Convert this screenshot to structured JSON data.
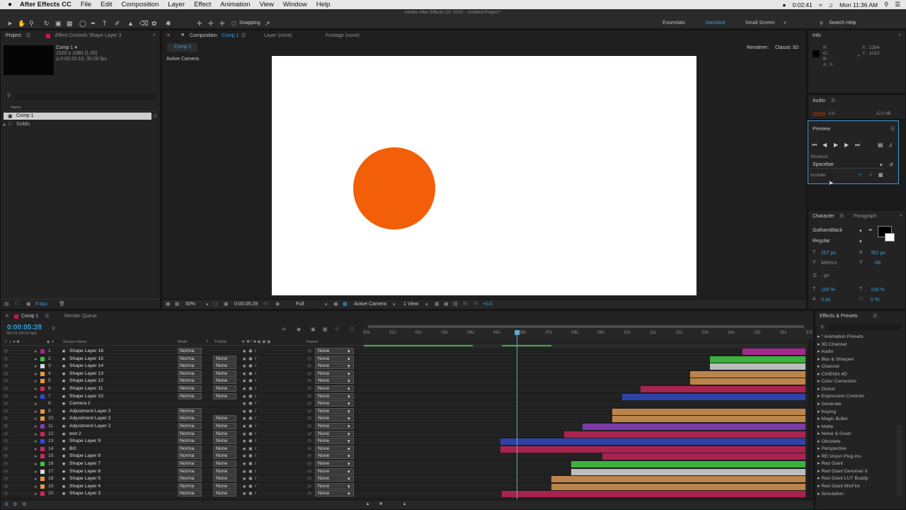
{
  "menubar": {
    "app": "After Effects CC",
    "items": [
      "File",
      "Edit",
      "Composition",
      "Layer",
      "Effect",
      "Animation",
      "View",
      "Window",
      "Help"
    ],
    "time": "0:02:41",
    "clock": "Mon 11:36 AM"
  },
  "app_title": "Adobe After Effects CC 2015 - Untitled Project *",
  "toolbar": {
    "snapping": "Snapping",
    "workspaces": [
      "Essentials",
      "Standard",
      "Small Screen"
    ],
    "active_workspace": "Standard",
    "search_help": "Search Help"
  },
  "project": {
    "tab": "Project",
    "effect_controls": "Effect Controls Shape Layer 3",
    "comp_name": "Comp 1 ▾",
    "comp_info1": "1920 x 1080 (1.00)",
    "comp_info2": "Δ 0:00:20:10, 30.00 fps",
    "col_name": "Name",
    "items": [
      "Comp 1",
      "Solids"
    ],
    "bpc": "8 bpc"
  },
  "composition": {
    "tab_prefix": "Composition",
    "tab_name": "Comp 1",
    "layer_tab": "Layer (none)",
    "footage_tab": "Footage (none)",
    "crumb": "Comp 1",
    "renderer_label": "Renderer:",
    "renderer": "Classic 3D",
    "camera": "Active Camera",
    "zoom": "50%",
    "timecode": "0:00:05:28",
    "resolution": "Full",
    "camera_select": "Active Camera",
    "view": "1 View",
    "exposure": "+0.0",
    "circle_color": "#f25f08"
  },
  "info": {
    "title": "Info",
    "r": "R :",
    "g": "G :",
    "b": "B :",
    "a": "A : 0",
    "x": "X : 2294",
    "y": "Y : 1010"
  },
  "audio": {
    "title": "Audio",
    "left": "0.0",
    "right": "12.0 dB"
  },
  "preview": {
    "title": "Preview",
    "shortcut_label": "Shortcut",
    "shortcut": "Spacebar",
    "include": "Include:"
  },
  "character": {
    "tab1": "Character",
    "tab2": "Paragraph",
    "font": "GothamBlack",
    "style": "Regular",
    "size": "257 px",
    "leading": "352 px",
    "kerning": "Metrics",
    "tracking": "-68",
    "stroke": "- px",
    "vscale": "100 %",
    "hscale": "100 %",
    "baseline": "0 px",
    "tsume": "0 %"
  },
  "timeline": {
    "tab": "Comp 1",
    "render_queue": "Render Queue",
    "timecode": "0:00:05:28",
    "frames": "00178 (30.00 fps)",
    "col_source": "Source Name",
    "col_mode": "Mode",
    "col_t": "T",
    "col_trkmat": "TrkMat",
    "col_parent": "Parent",
    "ruler": [
      "00s",
      "01s",
      "02s",
      "03s",
      "04s",
      "05s",
      "06s",
      "07s",
      "08s",
      "09s",
      "10s",
      "11s",
      "12s",
      "13s",
      "14s",
      "15s",
      "16s",
      "17s"
    ],
    "layers": [
      {
        "n": "1",
        "name": "Shape Layer 16",
        "color": "#b3238f",
        "mode": "Norma",
        "trk": "",
        "parent": "None",
        "bar": [
          1048,
          1137
        ],
        "barcolor": "#a32a8c"
      },
      {
        "n": "2",
        "name": "Shape Layer 15",
        "color": "#3fc23f",
        "mode": "Norma",
        "trk": "None",
        "parent": "None",
        "bar": [
          1002,
          1137
        ],
        "barcolor": "#3bb23b"
      },
      {
        "n": "3",
        "name": "Shape Layer 14",
        "color": "#d9d9d9",
        "mode": "Norma",
        "trk": "None",
        "parent": "None",
        "bar": [
          1002,
          1137
        ],
        "barcolor": "#bdbdbd"
      },
      {
        "n": "4",
        "name": "Shape Layer 13",
        "color": "#e89a3c",
        "mode": "Norma",
        "trk": "None",
        "parent": "None",
        "bar": [
          974,
          1137
        ],
        "barcolor": "#bb844a"
      },
      {
        "n": "5",
        "name": "Shape Layer 12",
        "color": "#e89a3c",
        "mode": "Norma",
        "trk": "None",
        "parent": "None",
        "bar": [
          974,
          1137
        ],
        "barcolor": "#bb844a"
      },
      {
        "n": "6",
        "name": "Shape Layer 11",
        "color": "#d0275a",
        "mode": "Norma",
        "trk": "None",
        "parent": "None",
        "bar": [
          904,
          1137
        ],
        "barcolor": "#a8244f"
      },
      {
        "n": "7",
        "name": "Shape Layer 10",
        "color": "#2f4bd0",
        "mode": "Norma",
        "trk": "None",
        "parent": "None",
        "bar": [
          878,
          1137
        ],
        "barcolor": "#2f42a8"
      },
      {
        "n": "8",
        "name": "Camera 2",
        "color": "",
        "mode": "",
        "trk": "",
        "parent": "None",
        "bar": null,
        "barcolor": ""
      },
      {
        "n": "9",
        "name": "Adjustment Layer 2",
        "color": "#e89a3c",
        "mode": "Norma",
        "trk": "",
        "parent": "None",
        "bar": [
          864,
          1137
        ],
        "barcolor": "#bb844a"
      },
      {
        "n": "10",
        "name": "Adjustment Layer 2",
        "color": "#e89a3c",
        "mode": "Norma",
        "trk": "None",
        "parent": "None",
        "bar": [
          864,
          1137
        ],
        "barcolor": "#bb844a"
      },
      {
        "n": "11",
        "name": "Adjustment Layer 2",
        "color": "#8a3bb8",
        "mode": "Norma",
        "trk": "None",
        "parent": "None",
        "bar": [
          822,
          1137
        ],
        "barcolor": "#7a3aa8"
      },
      {
        "n": "12",
        "name": "text 2",
        "color": "#d0275a",
        "mode": "Norma",
        "trk": "None",
        "parent": "None",
        "bar": [
          796,
          1137
        ],
        "barcolor": "#a8244f"
      },
      {
        "n": "13",
        "name": "Shape Layer 9",
        "color": "#2f4bd0",
        "mode": "Norma",
        "trk": "None",
        "parent": "None",
        "bar": [
          706,
          1137
        ],
        "barcolor": "#2f42a8"
      },
      {
        "n": "14",
        "name": "BG",
        "color": "#d0275a",
        "mode": "Norma",
        "trk": "None",
        "parent": "None",
        "bar": [
          706,
          1137
        ],
        "barcolor": "#a8244f"
      },
      {
        "n": "15",
        "name": "Shape Layer 8",
        "color": "#d0275a",
        "mode": "Norma",
        "trk": "None",
        "parent": "None",
        "bar": [
          850,
          1137
        ],
        "barcolor": "#a8244f"
      },
      {
        "n": "16",
        "name": "Shape Layer 7",
        "color": "#3fc23f",
        "mode": "Norma",
        "trk": "None",
        "parent": "None",
        "bar": [
          806,
          1137
        ],
        "barcolor": "#3bb23b"
      },
      {
        "n": "17",
        "name": "Shape Layer 6",
        "color": "#d9d9d9",
        "mode": "Norma",
        "trk": "None",
        "parent": "None",
        "bar": [
          806,
          1137
        ],
        "barcolor": "#bdbdbd"
      },
      {
        "n": "18",
        "name": "Shape Layer 5",
        "color": "#e89a3c",
        "mode": "Norma",
        "trk": "None",
        "parent": "None",
        "bar": [
          778,
          1137
        ],
        "barcolor": "#bb844a"
      },
      {
        "n": "19",
        "name": "Shape Layer 4",
        "color": "#e89a3c",
        "mode": "Norma",
        "trk": "None",
        "parent": "None",
        "bar": [
          778,
          1137
        ],
        "barcolor": "#bb844a"
      },
      {
        "n": "20",
        "name": "Shape Layer 3",
        "color": "#d0275a",
        "mode": "Norma",
        "trk": "None",
        "parent": "None",
        "bar": [
          708,
          1137
        ],
        "barcolor": "#a8244f"
      }
    ]
  },
  "effects": {
    "title": "Effects & Presets",
    "items": [
      "* Animation Presets",
      "3D Channel",
      "Audio",
      "Blur & Sharpen",
      "Channel",
      "CINEMA 4D",
      "Color Correction",
      "Distort",
      "Expression Controls",
      "Generate",
      "Keying",
      "Magic Bullet",
      "Matte",
      "Noise & Grain",
      "Obsolete",
      "Perspective",
      "RE:Vision Plug-ins",
      "Red Giant",
      "Red Giant Denoiser II",
      "Red Giant LUT Buddy",
      "Red Giant MisFire",
      "Simulation"
    ]
  }
}
